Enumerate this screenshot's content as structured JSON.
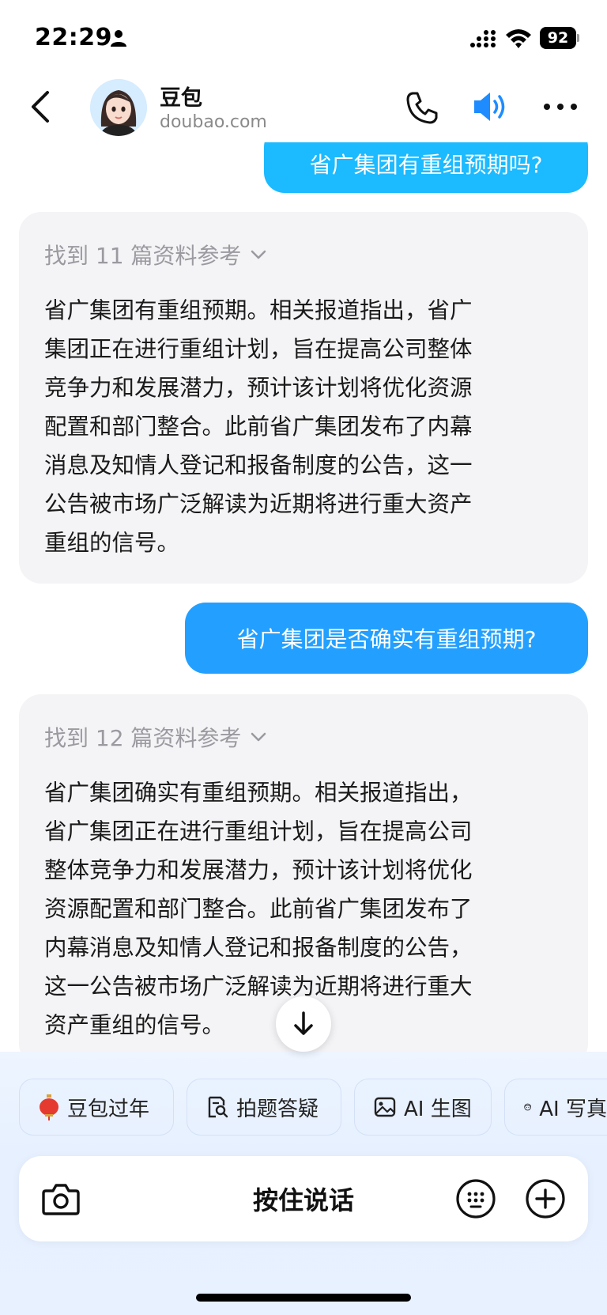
{
  "status_bar": {
    "time": "22:29",
    "battery": "92"
  },
  "header": {
    "name": "豆包",
    "domain": "doubao.com"
  },
  "messages": [
    {
      "role": "user",
      "text": "省广集团有重组预期吗?"
    },
    {
      "role": "bot",
      "refs": "找到 11 篇资料参考",
      "lines": [
        "省广集团有重组预期。相关报道指出，省广",
        "集团正在进行重组计划，旨在提高公司整体",
        "竞争力和发展潜力，预计该计划将优化资源",
        "配置和部门整合。此前省广集团发布了内幕",
        "消息及知情人登记和报备制度的公告，这一",
        "公告被市场广泛解读为近期将进行重大资产",
        "重组的信号。"
      ]
    },
    {
      "role": "user",
      "text": "省广集团是否确实有重组预期?"
    },
    {
      "role": "bot",
      "refs": "找到 12 篇资料参考",
      "lines": [
        "省广集团确实有重组预期。相关报道指出，",
        "省广集团正在进行重组计划，旨在提高公司",
        "整体竞争力和发展潜力，预计该计划将优化",
        "资源配置和部门整合。此前省广集团发布了",
        "内幕消息及知情人登记和报备制度的公告，",
        "这一公告被市场广泛解读为近期将进行重大",
        "资产重组的信号。"
      ]
    }
  ],
  "chips": [
    {
      "label": "豆包过年",
      "icon": "lantern-icon"
    },
    {
      "label": "拍题答疑",
      "icon": "photo-search-icon"
    },
    {
      "label": "AI 生图",
      "icon": "image-icon"
    },
    {
      "label": "AI 写真",
      "icon": "face-icon"
    }
  ],
  "composer": {
    "hold_to_talk": "按住说话"
  },
  "colors": {
    "user_bubble": "#23a0ff",
    "user_bubble_alt": "#1cbaff",
    "bot_bubble": "#f4f4f6",
    "accent": "#1e8cff"
  }
}
